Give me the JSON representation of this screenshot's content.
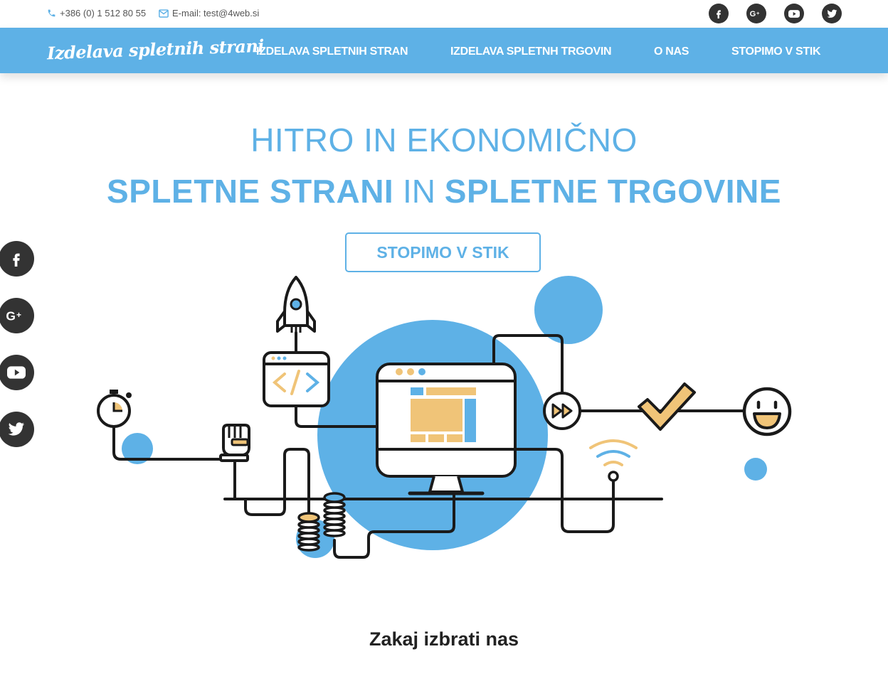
{
  "topbar": {
    "phone": "+386 (0) 1 512 80 55",
    "email": "E-mail: test@4web.si",
    "social_icons": [
      "facebook-icon",
      "google-plus-icon",
      "youtube-icon",
      "twitter-icon"
    ]
  },
  "nav": {
    "brand": "Izdelava spletnih strani",
    "items": [
      {
        "label": "IZDELAVA SPLETNIH STRAN"
      },
      {
        "label": "IZDELAVA SPLETNH TRGOVIN"
      },
      {
        "label": "O NAS"
      },
      {
        "label": "STOPIMO V STIK"
      }
    ]
  },
  "hero": {
    "line1": "HITRO IN EKONOMIČNO",
    "line2_part1": "SPLETNE STRANI",
    "line2_part2": " IN ",
    "line2_part3": "SPLETNE TRGOVINE",
    "cta_label": "STOPIMO V STIK"
  },
  "side_social": {
    "icons": [
      "facebook-icon",
      "google-plus-icon",
      "youtube-icon",
      "twitter-icon"
    ]
  },
  "illustration": {
    "icons": [
      "stopwatch-icon",
      "raised-fist-icon",
      "rocket-icon",
      "code-window-icon",
      "coin-stack-icon",
      "desktop-monitor-icon",
      "fast-forward-icon",
      "checkmark-icon",
      "smiley-icon",
      "wifi-icon"
    ]
  },
  "section": {
    "title": "Zakaj izbrati nas"
  },
  "colors": {
    "accent": "#5eb1e6",
    "dark": "#333333",
    "illustration_yellow": "#f0c478"
  }
}
